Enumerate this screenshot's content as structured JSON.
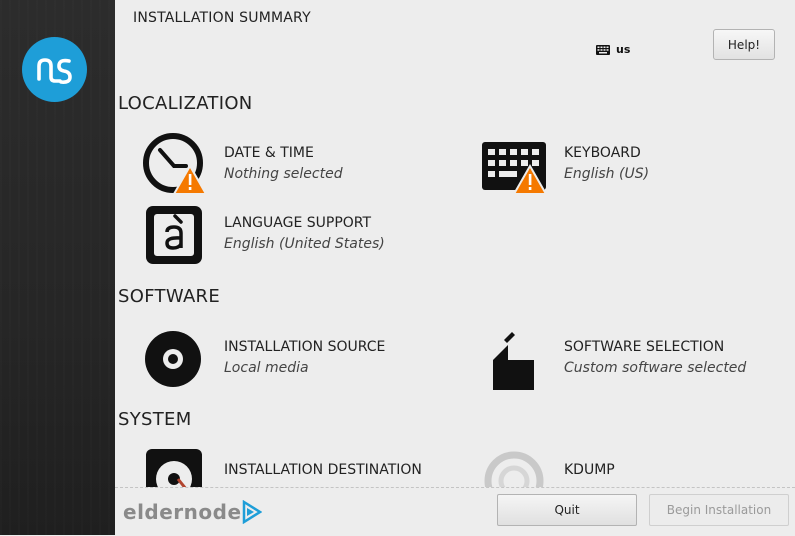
{
  "header": {
    "title": "INSTALLATION SUMMARY",
    "keyboard_layout": "us",
    "help_label": "Help!"
  },
  "sections": {
    "localization": "LOCALIZATION",
    "software": "SOFTWARE",
    "system": "SYSTEM"
  },
  "spokes": {
    "date_time": {
      "title": "DATE & TIME",
      "status": "Nothing selected",
      "icon": "clock-icon",
      "warning": true
    },
    "keyboard": {
      "title": "KEYBOARD",
      "status": "English (US)",
      "icon": "keyboard-icon",
      "warning": true
    },
    "language": {
      "title": "LANGUAGE SUPPORT",
      "status": "English (United States)",
      "icon": "language-icon"
    },
    "install_source": {
      "title": "INSTALLATION SOURCE",
      "status": "Local media",
      "icon": "disc-icon"
    },
    "software_selection": {
      "title": "SOFTWARE SELECTION",
      "status": "Custom software selected",
      "icon": "package-icon"
    },
    "install_destination": {
      "title": "INSTALLATION DESTINATION",
      "icon": "harddisk-icon"
    },
    "kdump": {
      "title": "KDUMP",
      "icon": "kdump-icon"
    }
  },
  "footer": {
    "quit_label": "Quit",
    "begin_label": "Begin Installation",
    "watermark": "eldernode"
  },
  "colors": {
    "brand": "#1e9ed8",
    "warning": "#f57900",
    "sidebar": "#262626"
  }
}
